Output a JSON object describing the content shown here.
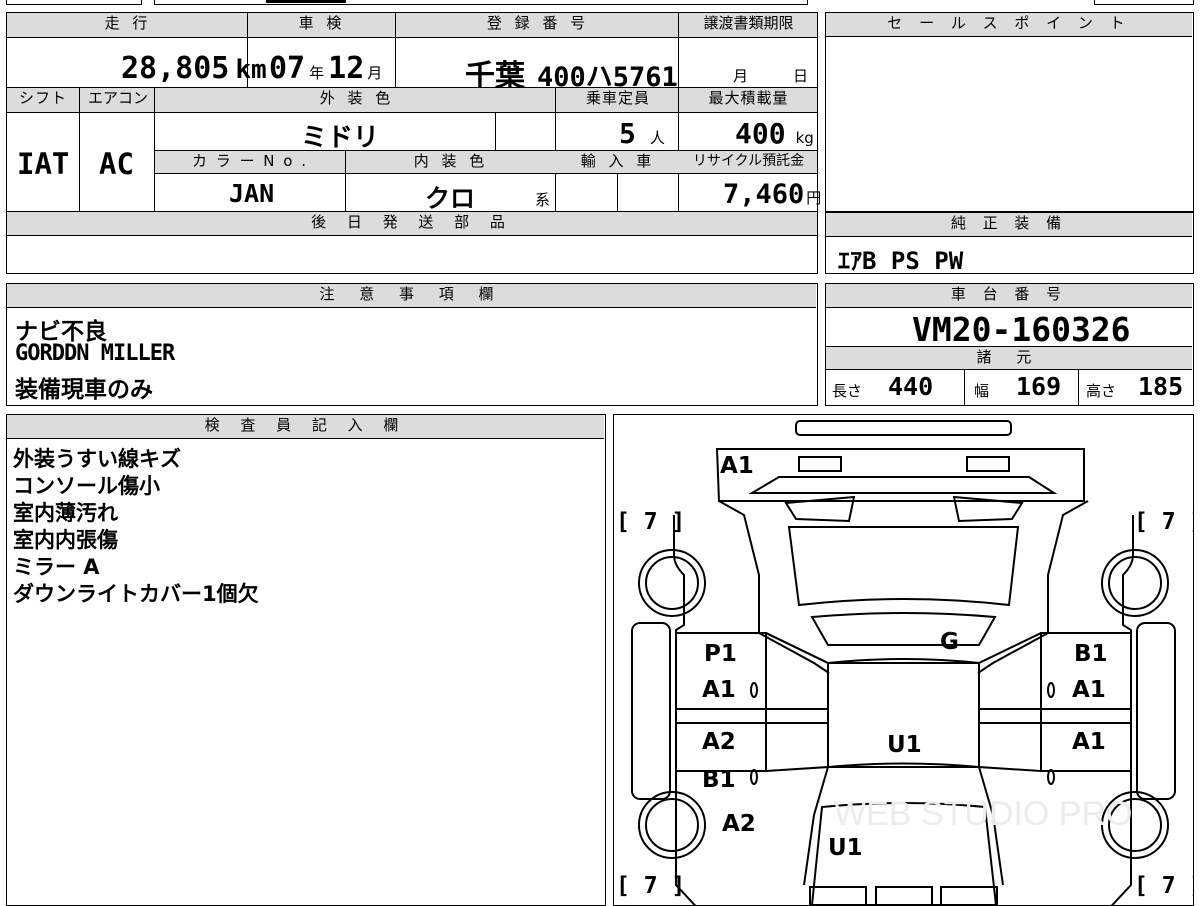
{
  "top_table": {
    "headers": {
      "mileage": "走 行",
      "inspection": "車 検",
      "registration": "登 録 番 号",
      "transfer_deadline": "譲渡書類期限",
      "shift": "シフト",
      "aircon": "エアコン",
      "exterior_color": "外 装 色",
      "capacity": "乗車定員",
      "max_load": "最大積載量",
      "color_no": "カ ラ ー N o .",
      "interior_color": "内 装 色",
      "import": "輸 入 車",
      "recycle": "リサイクル預託金"
    },
    "mileage_value": "28,805",
    "mileage_unit": "km",
    "inspection_year": "07",
    "inspection_year_unit": "年",
    "inspection_month": "12",
    "inspection_month_unit": "月",
    "plate_region": "千葉",
    "plate_number": "400ハ5761",
    "deadline_month_unit": "月",
    "deadline_day_unit": "日",
    "shift_value": "IAT",
    "aircon_value": "AC",
    "exterior_color_value": "ミドリ",
    "capacity_value": "5",
    "capacity_unit": "人",
    "max_load_value": "400",
    "max_load_unit": "kg",
    "color_no_value": "JAN",
    "interior_color_value": "クロ",
    "interior_color_suffix": "系",
    "recycle_value": "7,460",
    "recycle_unit": "円"
  },
  "later_parts": {
    "header": "後 日 発 送 部 品",
    "value": ""
  },
  "sales_points": {
    "header": "セ ー ル ス ポ イ ン ト",
    "value": ""
  },
  "genuine_equipment": {
    "header": "純 正 装 備",
    "value": "ｴｱB PS PW"
  },
  "notes": {
    "header": "注 意 事 項 欄",
    "lines": [
      "ナビ不良",
      "GORDDN MILLER",
      "装備現車のみ"
    ]
  },
  "chassis": {
    "header": "車 台 番 号",
    "value": "VM20-160326"
  },
  "specs": {
    "header": "諸 元",
    "length_label": "長さ",
    "length_value": "440",
    "width_label": "幅",
    "width_value": "169",
    "height_label": "高さ",
    "height_value": "185"
  },
  "inspector": {
    "header": "検 査 員 記 入 欄",
    "lines": [
      "外装うすい線キズ",
      "コンソール傷小",
      "室内薄汚れ",
      "室内内張傷",
      "ミラー A",
      "ダウンライトカバー1個欠"
    ]
  },
  "diagram": {
    "tire_marks": [
      "[ 7 ]",
      "[ 7 ]",
      "[ 7 ]",
      "[ 7 ]"
    ],
    "marks": {
      "front": "A1",
      "windshield": "G",
      "left_front_door_1": "P1",
      "left_front_door_2": "A1",
      "left_rear_door_1": "A2",
      "left_rear_door_2": "B1",
      "right_front_door_1": "B1",
      "right_front_door_2": "A1",
      "right_rear_door": "A1",
      "interior": "U1",
      "left_rear_fender": "A2",
      "rear": "U1"
    },
    "watermark": "WEB STUDIO PRO"
  }
}
